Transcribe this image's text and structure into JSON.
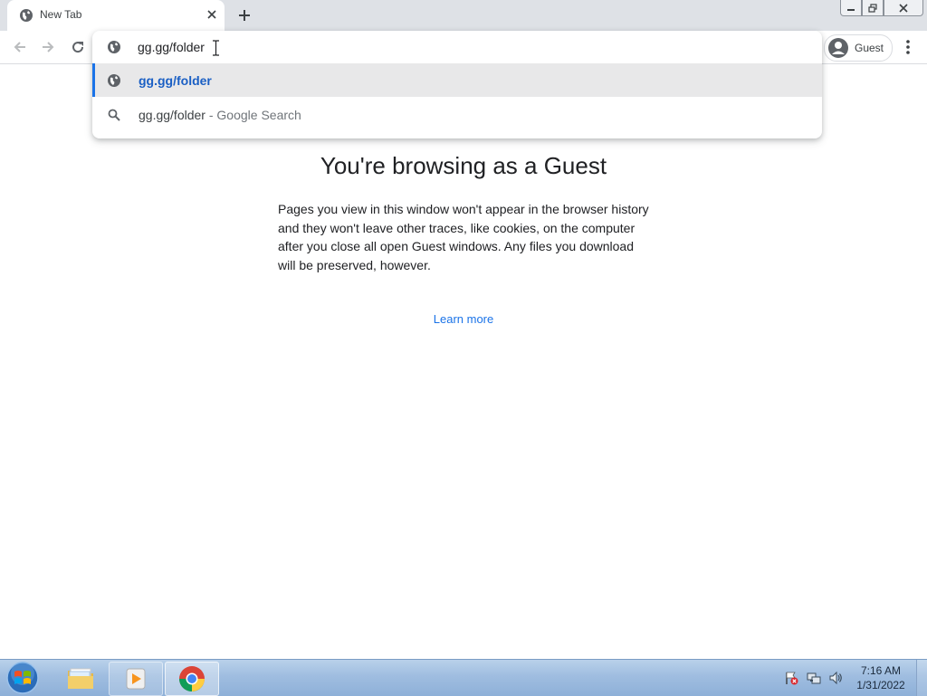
{
  "tab": {
    "title": "New Tab"
  },
  "omnibox": {
    "value": "gg.gg/folder",
    "suggestions": [
      {
        "text": "gg.gg/folder",
        "type": "url"
      },
      {
        "text": "gg.gg/folder",
        "separator": " - ",
        "description": "Google Search",
        "type": "search"
      }
    ]
  },
  "profile": {
    "label": "Guest"
  },
  "page": {
    "title": "You're browsing as a Guest",
    "body": "Pages you view in this window won't appear in the browser history and they won't leave other traces, like cookies, on the computer after you close all open Guest windows. Any files you download will be preserved, however.",
    "learn_more": "Learn more"
  },
  "taskbar": {
    "time": "7:16 AM",
    "date": "1/31/2022"
  },
  "colors": {
    "accent": "#1a73e8",
    "tabstrip": "#dee1e6",
    "selected_suggestion": "#e8e8e9"
  }
}
